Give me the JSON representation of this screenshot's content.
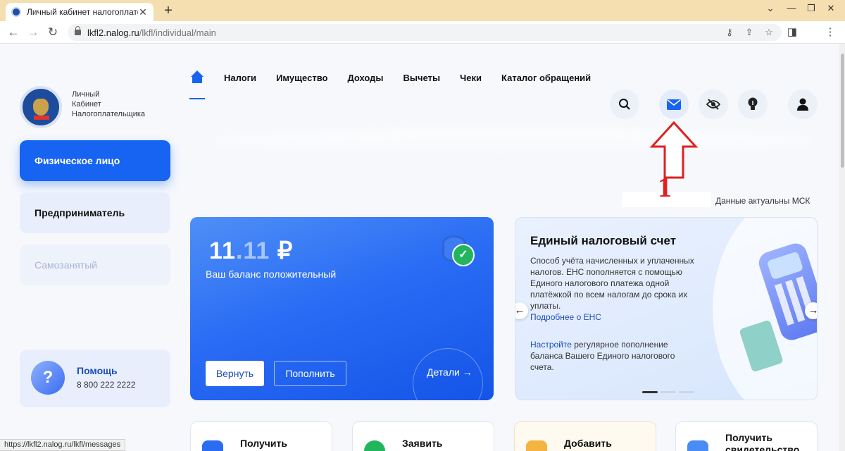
{
  "browser": {
    "tab_title": "Личный кабинет налогоплате",
    "tab_close": "✕",
    "new_tab": "+",
    "url_host": "lkfl2.nalog.ru",
    "url_path": "/lkfl/individual/main",
    "status_url": "https://lkfl2.nalog.ru/lkfl/messages",
    "window_min": "—",
    "window_restore": "❐",
    "window_close": "✕",
    "tab_overflow": "⌄"
  },
  "brand": {
    "line1": "Личный",
    "line2": "Кабинет",
    "line3": "Налогоплательщика"
  },
  "sidebar": {
    "items": [
      {
        "label": "Физическое лицо"
      },
      {
        "label": "Предприниматель"
      },
      {
        "label": "Самозанятый"
      }
    ],
    "help": {
      "title": "Помощь",
      "phone": "8 800 222 2222",
      "icon": "?"
    }
  },
  "topnav": {
    "links": [
      "Налоги",
      "Имущество",
      "Доходы",
      "Вычеты",
      "Чеки",
      "Каталог обращений"
    ]
  },
  "icons": {
    "search": "search-icon",
    "messages": "envelope-icon",
    "visibility": "eye-off-icon",
    "tips": "lightbulb-icon",
    "profile": "user-icon"
  },
  "annotation": {
    "number": "1",
    "color": "#e02020"
  },
  "data_actual": "Данные актуальны  МСК",
  "balance": {
    "amount_int": "11",
    "amount_dec": ".11",
    "currency": " ₽",
    "message": "Ваш баланс положительный",
    "return_label": "Вернуть",
    "topup_label": "Пополнить",
    "details_label": "Детали",
    "check": "✓"
  },
  "ens": {
    "title": "Единый налоговый счет",
    "text": "Способ учёта начисленных и уплаченных налогов. ЕНС пополняется с помощью Единого налогового платежа одной платёжкой по всем налогам до срока их уплаты.",
    "more_link": "Подробнее о ЕНС",
    "setup_link": "Настройте",
    "setup_text": " регулярное пополнение баланса Вашего Единого налогового счета.",
    "prev": "←",
    "next": "→"
  },
  "tiles": [
    {
      "label": "Получить"
    },
    {
      "label": "Заявить"
    },
    {
      "label": "Добавить"
    },
    {
      "label": "Получить свидетельство"
    }
  ],
  "colors": {
    "accent": "#1763f2",
    "link": "#1c4fb9",
    "chrome": "#f5deb0"
  }
}
